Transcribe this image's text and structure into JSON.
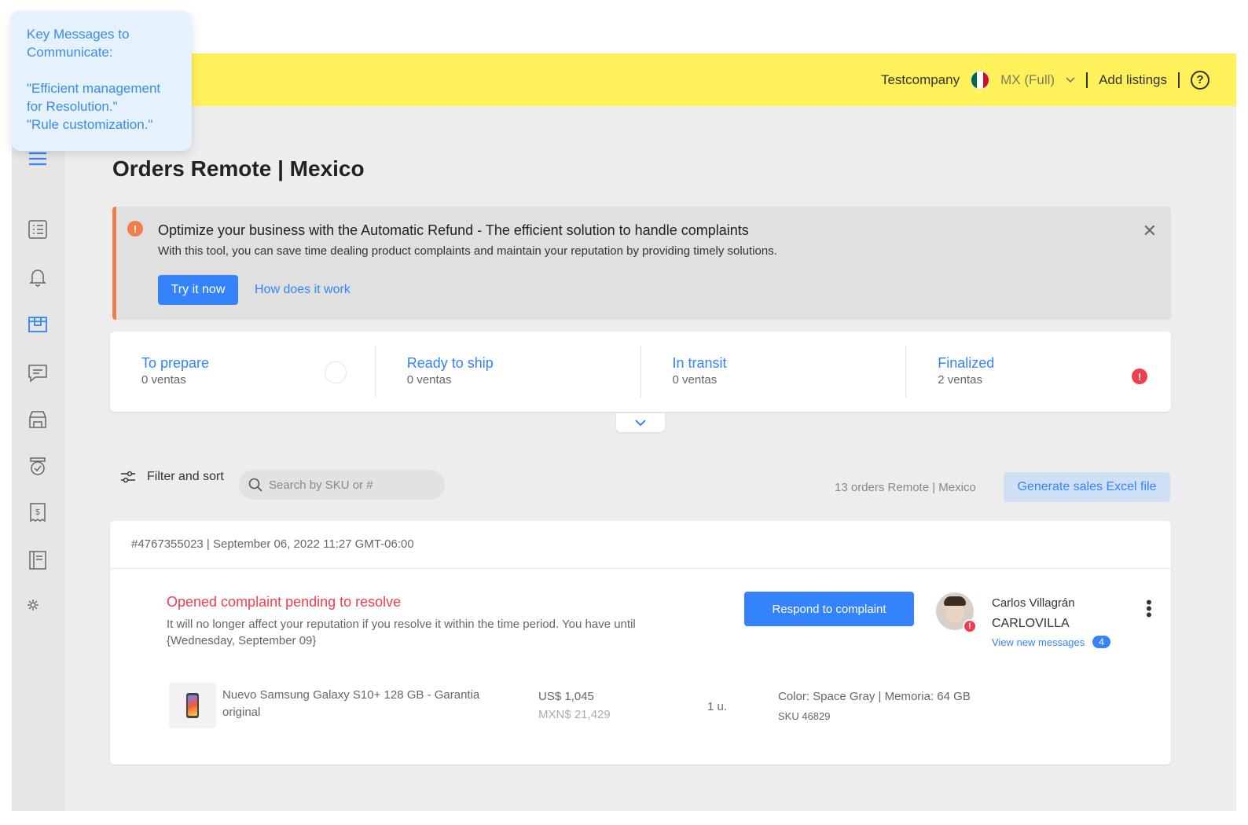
{
  "tooltip": {
    "text": "Key Messages to Communicate:\n\n\"Efficient management for Resolution.\"\n\"Rule customization.\""
  },
  "topbar": {
    "company": "Testcompany",
    "site": "MX (Full)",
    "add_listings": "Add listings",
    "help": "?"
  },
  "page": {
    "title": "Orders Remote | Mexico"
  },
  "banner": {
    "title": "Optimize your business with the Automatic Refund - The efficient solution to handle complaints",
    "description": "With this tool, you can save time dealing product complaints and maintain your reputation by providing timely solutions.",
    "try_label": "Try it now",
    "how_label": "How does it work"
  },
  "statuses": [
    {
      "label": "To prepare",
      "count": "0 ventas"
    },
    {
      "label": "Ready to ship",
      "count": "0 ventas"
    },
    {
      "label": "In transit",
      "count": "0 ventas"
    },
    {
      "label": "Finalized",
      "count": "2 ventas"
    }
  ],
  "toolbar": {
    "filter_label": "Filter and sort",
    "search_placeholder": "Search by SKU or #",
    "order_count": "13 orders Remote | Mexico",
    "excel_label": "Generate sales Excel file"
  },
  "order": {
    "header": "#4767355023 | September 06, 2022 11:27 GMT-06:00",
    "complaint_title": "Opened complaint pending to resolve",
    "complaint_desc": "It will no longer affect your reputation if you resolve it within the time period. You have until {Wednesday, September 09}",
    "respond_label": "Respond to complaint",
    "buyer_name": "Carlos Villagrán",
    "buyer_nick": "CARLOVILLA",
    "view_messages": "View new messages",
    "message_count": "4",
    "product_name": "Nuevo Samsung Galaxy S10+ 128 GB - Garantia original",
    "price_usd": "US$ 1,045",
    "price_mxn": "MXN$ 21,429",
    "quantity": "1 u.",
    "variant": "Color: Space Gray | Memoria: 64 GB",
    "sku": "SKU 46829"
  },
  "colors": {
    "topbar": "#fff159",
    "accent_blue": "#3483fa",
    "alert_red": "#f23d4f",
    "warning_orange": "#f07f4f"
  },
  "icons": {
    "sidebar": [
      "menu-icon",
      "list-icon",
      "bell-icon",
      "box-icon",
      "chat-icon",
      "store-icon",
      "badge-icon",
      "invoice-icon",
      "ledger-icon",
      "settings-icon"
    ]
  }
}
